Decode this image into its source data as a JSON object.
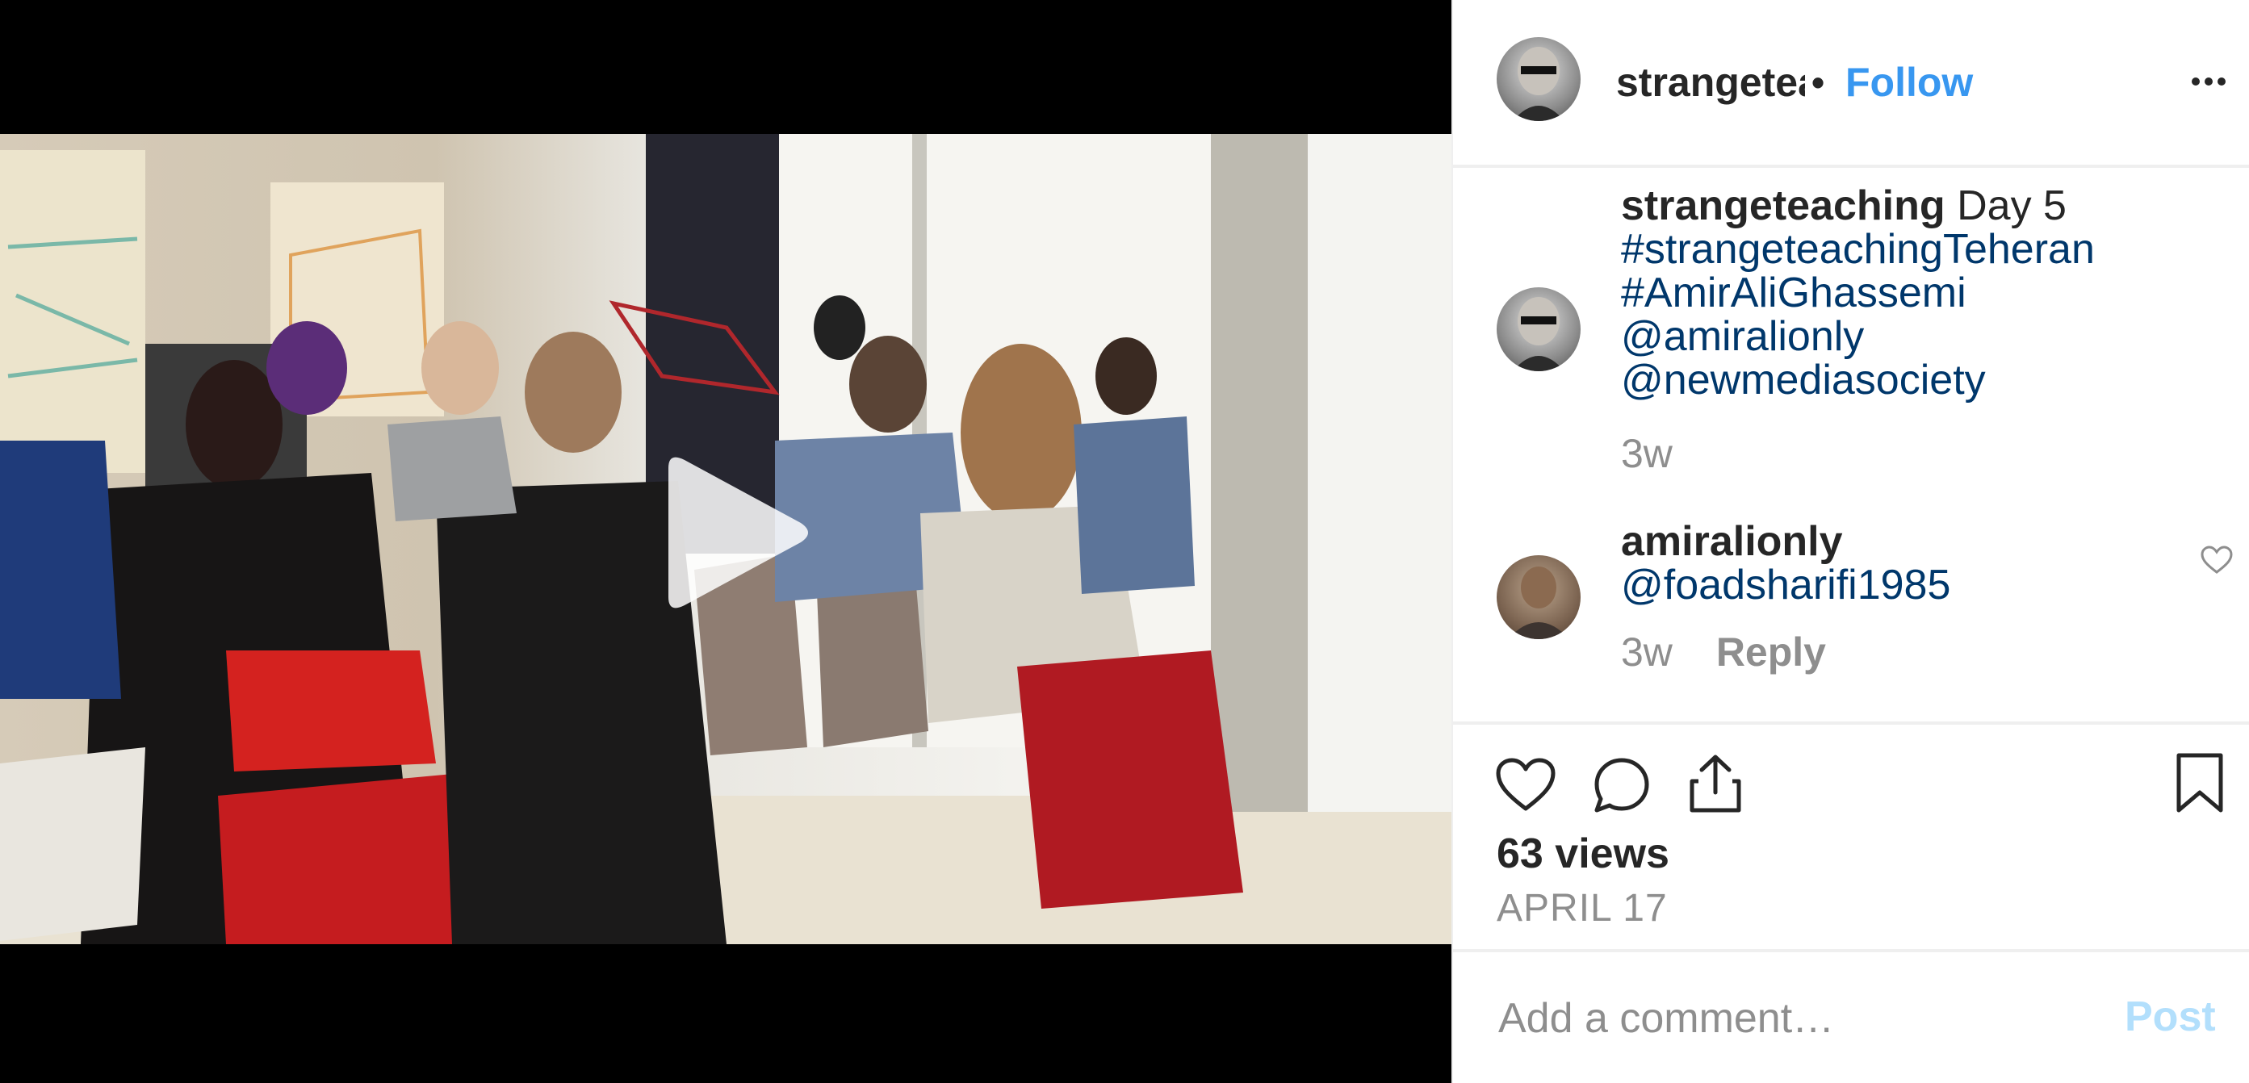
{
  "post": {
    "username": "strangeteaching",
    "dot": "•",
    "follow_label": "Follow",
    "more_icon": "more-horizontal-icon",
    "media_icon": "play-icon"
  },
  "caption": {
    "username": "strangeteaching",
    "text": "Day 5",
    "lines": [
      "#strangeteachingTeheran",
      "#AmirAliGhassemi",
      "@amiralionly",
      "@newmediasociety"
    ],
    "time": "3w"
  },
  "comment": {
    "username": "amiralionly",
    "text": "@foadsharifi1985",
    "time": "3w",
    "reply_label": "Reply",
    "like_icon": "heart-small-icon"
  },
  "actions": {
    "like_icon": "heart-icon",
    "comment_icon": "comment-icon",
    "share_icon": "share-icon",
    "save_icon": "bookmark-icon"
  },
  "stats": {
    "views": "63 views",
    "date": "APRIL 17"
  },
  "composer": {
    "placeholder": "Add a comment…",
    "post_label": "Post"
  },
  "colors": {
    "accent": "#3897f0",
    "text": "#262626",
    "link": "#00376b",
    "muted": "#8e8e8e",
    "divider": "#efefef"
  }
}
